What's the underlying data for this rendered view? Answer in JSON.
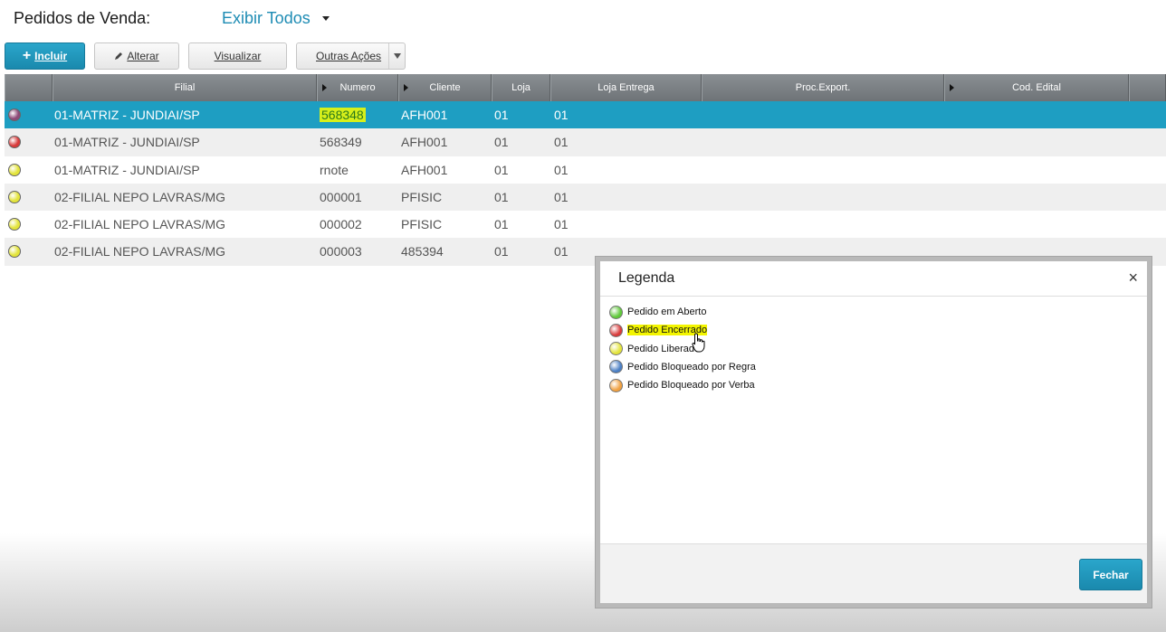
{
  "header": {
    "title": "Pedidos de Venda:",
    "filter_value": "Exibir Todos"
  },
  "toolbar": {
    "incluir": "Incluir",
    "alterar": "Alterar",
    "visualizar": "Visualizar",
    "outras_acoes": "Outras Ações"
  },
  "grid": {
    "columns": [
      "Filial",
      "Numero",
      "Cliente",
      "Loja",
      "Loja Entrega",
      "Proc.Export.",
      "Cod. Edital"
    ],
    "rows": [
      {
        "status_color": "#8e4a78",
        "filial": "01-MATRIZ - JUNDIAI/SP",
        "numero": "568348",
        "cliente": "AFH001",
        "loja": "01",
        "loja_entrega": "01"
      },
      {
        "status_color": "#d83a3a",
        "filial": "01-MATRIZ - JUNDIAI/SP",
        "numero": "568349",
        "cliente": "AFH001",
        "loja": "01",
        "loja_entrega": "01"
      },
      {
        "status_color": "#e3e43a",
        "filial": "01-MATRIZ - JUNDIAI/SP",
        "numero": "rnote",
        "cliente": "AFH001",
        "loja": "01",
        "loja_entrega": "01"
      },
      {
        "status_color": "#e3e43a",
        "filial": "02-FILIAL NEPO LAVRAS/MG",
        "numero": "000001",
        "cliente": "PFISIC",
        "loja": "01",
        "loja_entrega": "01"
      },
      {
        "status_color": "#e3e43a",
        "filial": "02-FILIAL NEPO LAVRAS/MG",
        "numero": "000002",
        "cliente": "PFISIC",
        "loja": "01",
        "loja_entrega": "01"
      },
      {
        "status_color": "#e3e43a",
        "filial": "02-FILIAL NEPO LAVRAS/MG",
        "numero": "000003",
        "cliente": "485394",
        "loja": "01",
        "loja_entrega": "01"
      }
    ]
  },
  "modal": {
    "title": "Legenda",
    "close": "×",
    "items": [
      {
        "label": "Pedido em Aberto",
        "color": "#5fc93a"
      },
      {
        "label": "Pedido Encerrado",
        "color": "#d83a3a"
      },
      {
        "label": "Pedido Liberado",
        "color": "#e3e43a"
      },
      {
        "label": "Pedido Bloqueado por Regra",
        "color": "#4a7fc4"
      },
      {
        "label": "Pedido Bloqueado por Verba",
        "color": "#f0a040"
      }
    ],
    "close_button": "Fechar"
  },
  "colors": {
    "accent": "#1e9ec2",
    "header_bg": "#7c8185",
    "highlight": "#d7ef1a"
  }
}
